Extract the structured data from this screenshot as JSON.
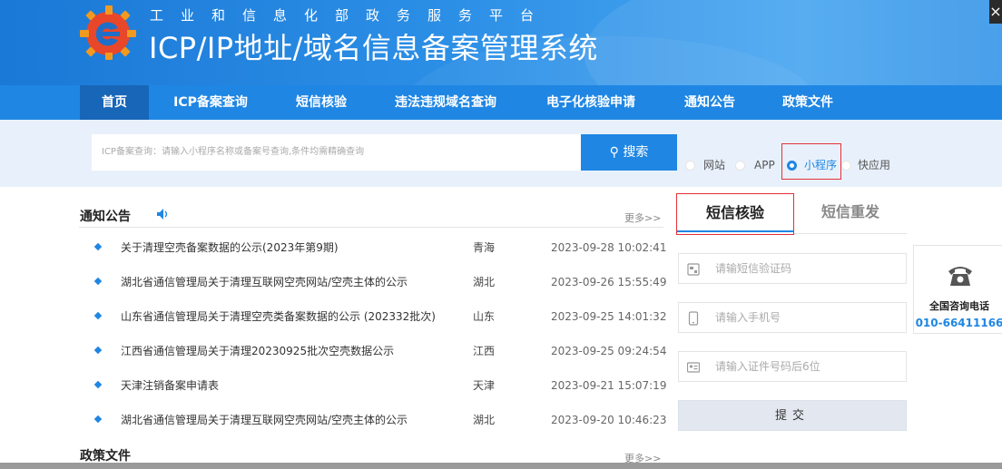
{
  "header": {
    "subtitle": "工业和信息化部政务服务平台",
    "title": "ICP/IP地址/域名信息备案管理系统",
    "close_label": "×"
  },
  "nav": {
    "items": [
      {
        "label": "首页"
      },
      {
        "label": "ICP备案查询"
      },
      {
        "label": "短信核验"
      },
      {
        "label": "违法违规域名查询"
      },
      {
        "label": "电子化核验申请"
      },
      {
        "label": "通知公告"
      },
      {
        "label": "政策文件"
      }
    ]
  },
  "search": {
    "placeholder": "ICP备案查询：请输入小程序名称或备案号查询,条件均需精确查询",
    "button_label": "搜索",
    "options": [
      {
        "label": "网站",
        "checked": false
      },
      {
        "label": "APP",
        "checked": false
      },
      {
        "label": "小程序",
        "checked": true
      },
      {
        "label": "快应用",
        "checked": false
      }
    ]
  },
  "notices": {
    "title": "通知公告",
    "more": "更多>>",
    "items": [
      {
        "title": "关于清理空壳备案数据的公示(2023年第9期)",
        "region": "青海",
        "date": "2023-09-28 10:02:41"
      },
      {
        "title": "湖北省通信管理局关于清理互联网空壳网站/空壳主体的公示",
        "region": "湖北",
        "date": "2023-09-26 15:55:49"
      },
      {
        "title": "山东省通信管理局关于清理空壳类备案数据的公示 (202332批次)",
        "region": "山东",
        "date": "2023-09-25 14:01:32"
      },
      {
        "title": "江西省通信管理局关于清理20230925批次空壳数据公示",
        "region": "江西",
        "date": "2023-09-25 09:24:54"
      },
      {
        "title": "天津注销备案申请表",
        "region": "天津",
        "date": "2023-09-21 15:07:19"
      },
      {
        "title": "湖北省通信管理局关于清理互联网空壳网站/空壳主体的公示",
        "region": "湖北",
        "date": "2023-09-20 10:46:23"
      }
    ]
  },
  "policy": {
    "title": "政策文件",
    "more": "更多>>"
  },
  "sms": {
    "tab_active": "短信核验",
    "tab_inactive": "短信重发",
    "code_placeholder": "请输短信验证码",
    "phone_placeholder": "请输入手机号",
    "id_placeholder": "请输入证件号码后6位",
    "submit_label": "提交"
  },
  "hotline": {
    "label": "全国咨询电话",
    "number": "010-66411166"
  },
  "colors": {
    "primary": "#1f86e3",
    "nav_active": "#1766b8",
    "highlight": "#e5303a"
  }
}
